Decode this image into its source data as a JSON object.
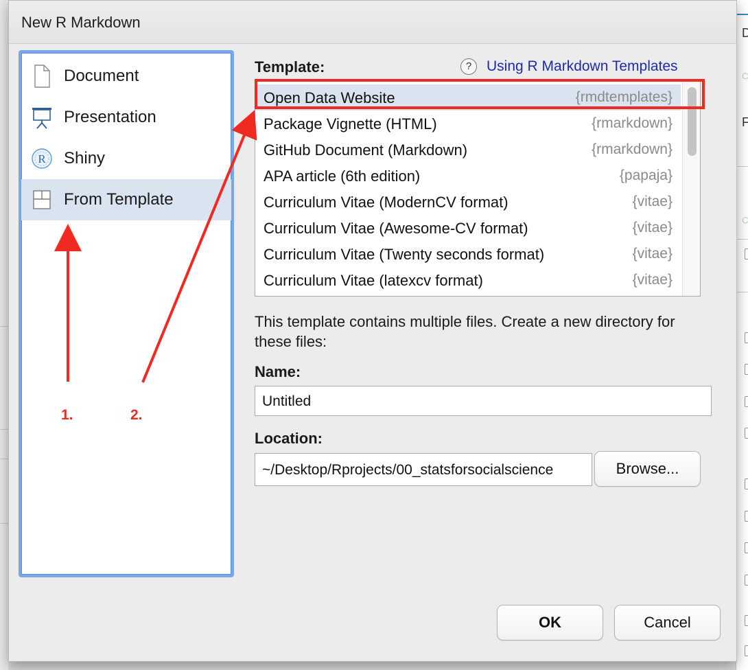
{
  "dialog": {
    "title": "New R Markdown"
  },
  "sidebar": {
    "items": [
      {
        "label": "Document",
        "icon": "document-icon"
      },
      {
        "label": "Presentation",
        "icon": "presentation-icon"
      },
      {
        "label": "Shiny",
        "icon": "shiny-r-icon"
      },
      {
        "label": "From Template",
        "icon": "template-icon",
        "selected": true
      }
    ]
  },
  "template": {
    "label": "Template:",
    "help_icon": "?",
    "help_link": "Using R Markdown Templates",
    "items": [
      {
        "name": "Open Data Website",
        "package": "{rmdtemplates}",
        "selected": true
      },
      {
        "name": "Package Vignette (HTML)",
        "package": "{rmarkdown}"
      },
      {
        "name": "GitHub Document (Markdown)",
        "package": "{rmarkdown}"
      },
      {
        "name": "APA article (6th edition)",
        "package": "{papaja}"
      },
      {
        "name": "Curriculum Vitae (ModernCV format)",
        "package": "{vitae}"
      },
      {
        "name": "Curriculum Vitae (Awesome-CV format)",
        "package": "{vitae}"
      },
      {
        "name": "Curriculum Vitae (Twenty seconds format)",
        "package": "{vitae}"
      },
      {
        "name": "Curriculum Vitae (latexcv format)",
        "package": "{vitae}"
      }
    ]
  },
  "description": "This template contains multiple files. Create a new directory for these files:",
  "name_field": {
    "label": "Name:",
    "value": "Untitled"
  },
  "location_field": {
    "label": "Location:",
    "value": "~/Desktop/Rprojects/00_statsforsocialscience",
    "browse_label": "Browse..."
  },
  "buttons": {
    "ok": "OK",
    "cancel": "Cancel"
  },
  "annotations": {
    "step1": "1.",
    "step2": "2.",
    "color": "#f02a20"
  },
  "colors": {
    "selection": "#dae4f0",
    "focus_ring": "#7aa7e8",
    "link": "#1d2bb0"
  }
}
